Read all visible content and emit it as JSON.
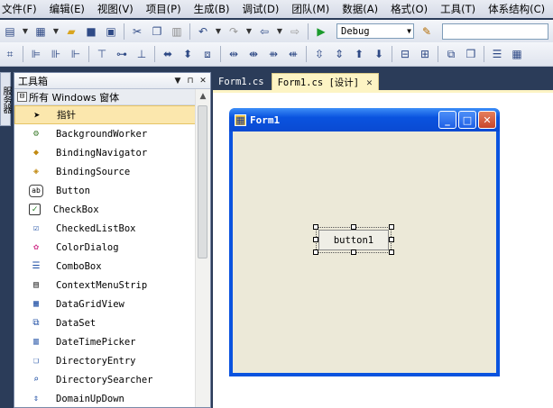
{
  "menubar": {
    "items": [
      "文件(F)",
      "编辑(E)",
      "视图(V)",
      "项目(P)",
      "生成(B)",
      "调试(D)",
      "团队(M)",
      "数据(A)",
      "格式(O)",
      "工具(T)",
      "体系结构(C)"
    ]
  },
  "toolbar": {
    "config_value": "Debug",
    "find_value": ""
  },
  "left_strip": {
    "label": "服务器"
  },
  "toolbox": {
    "title": "工具箱",
    "group": {
      "toggle": "⊟",
      "label": "所有 Windows 窗体"
    },
    "items": [
      {
        "label": "指针",
        "icon": "pointer-icon"
      },
      {
        "label": "BackgroundWorker",
        "icon": "background-worker-icon"
      },
      {
        "label": "BindingNavigator",
        "icon": "binding-navigator-icon"
      },
      {
        "label": "BindingSource",
        "icon": "binding-source-icon"
      },
      {
        "label": "Button",
        "icon": "button-icon"
      },
      {
        "label": "CheckBox",
        "icon": "checkbox-icon"
      },
      {
        "label": "CheckedListBox",
        "icon": "checked-listbox-icon"
      },
      {
        "label": "ColorDialog",
        "icon": "color-dialog-icon"
      },
      {
        "label": "ComboBox",
        "icon": "combobox-icon"
      },
      {
        "label": "ContextMenuStrip",
        "icon": "context-menu-icon"
      },
      {
        "label": "DataGridView",
        "icon": "datagrid-icon"
      },
      {
        "label": "DataSet",
        "icon": "dataset-icon"
      },
      {
        "label": "DateTimePicker",
        "icon": "datetime-picker-icon"
      },
      {
        "label": "DirectoryEntry",
        "icon": "directory-entry-icon"
      },
      {
        "label": "DirectorySearcher",
        "icon": "directory-searcher-icon"
      },
      {
        "label": "DomainUpDown",
        "icon": "domain-updown-icon"
      }
    ]
  },
  "tabs": [
    {
      "label": "Form1.cs",
      "active": false
    },
    {
      "label": "Form1.cs [设计]",
      "active": true
    }
  ],
  "form": {
    "title": "Form1",
    "button_text": "button1"
  },
  "colors": {
    "accent_dark": "#2b3c59",
    "title_blue": "#0a53df",
    "selection": "#fbe7ad",
    "form_bg": "#ece9d8",
    "close_red": "#c8452b"
  }
}
